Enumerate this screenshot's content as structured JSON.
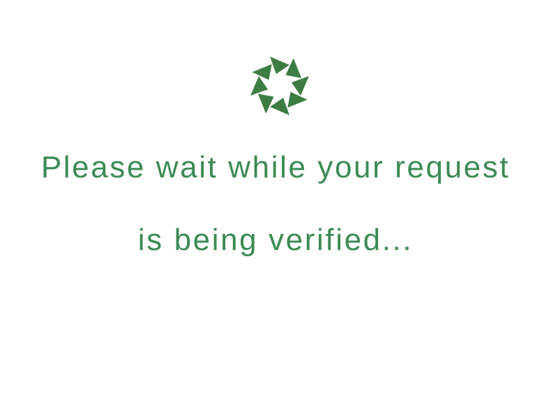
{
  "colors": {
    "accent": "#3d8b55",
    "spinner": "#3d7d44",
    "background": "#ffffff"
  },
  "spinner": {
    "icon": "loading-spinner-icon"
  },
  "message": {
    "line1": "Please wait while your request",
    "line2": "is being verified..."
  }
}
